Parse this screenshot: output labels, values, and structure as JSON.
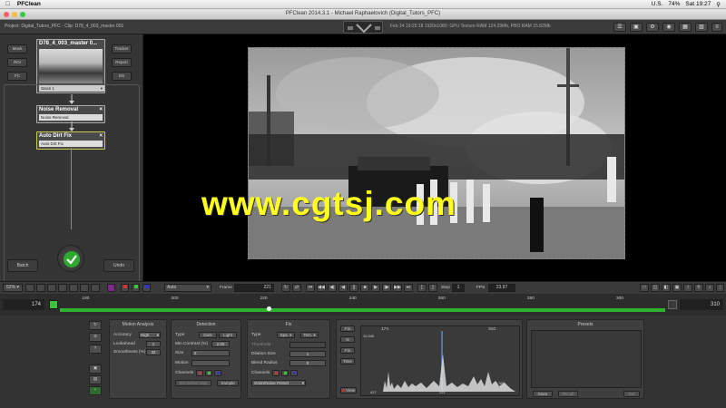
{
  "menubar": {
    "app_name": "PFClean",
    "battery": "74%",
    "time": "Sat 19:27",
    "region": "U.S."
  },
  "window": {
    "title": "PFClean 2014.3.1 - Michael Raphaelovich (Digital_Tutors_PFC)"
  },
  "toolbar": {
    "project": "Project: Digital_Tutors_PFC - Clip: D78_4_003_master 001",
    "info": "Feb 14 19:25:18 1920x1080: GPU Texture RAM 124.29Mb, PBO RAM 15.82Mb"
  },
  "left_panel": {
    "buttons_left": [
      "Mask",
      "ROI",
      "FC"
    ],
    "buttons_right": [
      "Tracker",
      "Report",
      "DS"
    ],
    "clip_name": "D78_4_003_master 0...",
    "stack": "Stack 1",
    "nodes": [
      {
        "title": "Noise Removal",
        "preset": "Noise Removal"
      },
      {
        "title": "Auto Dirt Fix",
        "preset": "Auto Dirt Fix"
      }
    ],
    "batch": "Batch",
    "undo": "Undo"
  },
  "transport": {
    "zoom": "52%",
    "mode": "Auto",
    "frame_label": "Frame",
    "frame_value": "221",
    "step_label": "Step",
    "step_value": "1",
    "fps_label": "FPS",
    "fps_value": "23.97"
  },
  "timeline": {
    "start": "174",
    "end": "310",
    "ticks": [
      "180",
      "200",
      "220",
      "240",
      "260",
      "280",
      "300"
    ],
    "current": 221,
    "range": [
      174,
      310
    ]
  },
  "motion_analysis": {
    "title": "Motion Analysis",
    "accuracy_label": "Accuracy",
    "accuracy_value": "High",
    "lookahead_label": "Lookahead",
    "lookahead_value": "1",
    "smoothness_label": "Smoothness (%)",
    "smoothness_value": "32"
  },
  "detection": {
    "title": "Detection",
    "type_label": "Type",
    "type_dark": "Dark",
    "type_light": "Light",
    "contrast_label": "Min Contrast (%)",
    "contrast_value": "2.00",
    "size_label": "Size",
    "size_value": "2",
    "motion_label": "Motion",
    "channels_label": "Channels",
    "set_button": "Set Defect Map",
    "sample_button": "Sample"
  },
  "fix": {
    "title": "Fix",
    "type_label": "Type",
    "type_spatial": "Spa.",
    "type_temporal": "Tem.",
    "threshold_label": "Threshold",
    "dilation_label": "Dilation Size",
    "dilation_value": "1",
    "blend_label": "Blend Radius",
    "blend_value": "0",
    "channels_label": "Channels",
    "preset_value": "Grain/Noise Preset"
  },
  "histogram": {
    "buttons": [
      "Fix",
      "N",
      "Fix",
      "Time"
    ],
    "view_button": "View",
    "top_left": "174",
    "top_right": "310",
    "y_left": "10,346",
    "bottom_left": "427",
    "bottom_mid": "221",
    "bottom_right": "2,388"
  },
  "presets": {
    "title": "Presets",
    "store": "Store",
    "recall": "Recall",
    "del": "Del"
  },
  "watermark": "www.cgtsj.com"
}
